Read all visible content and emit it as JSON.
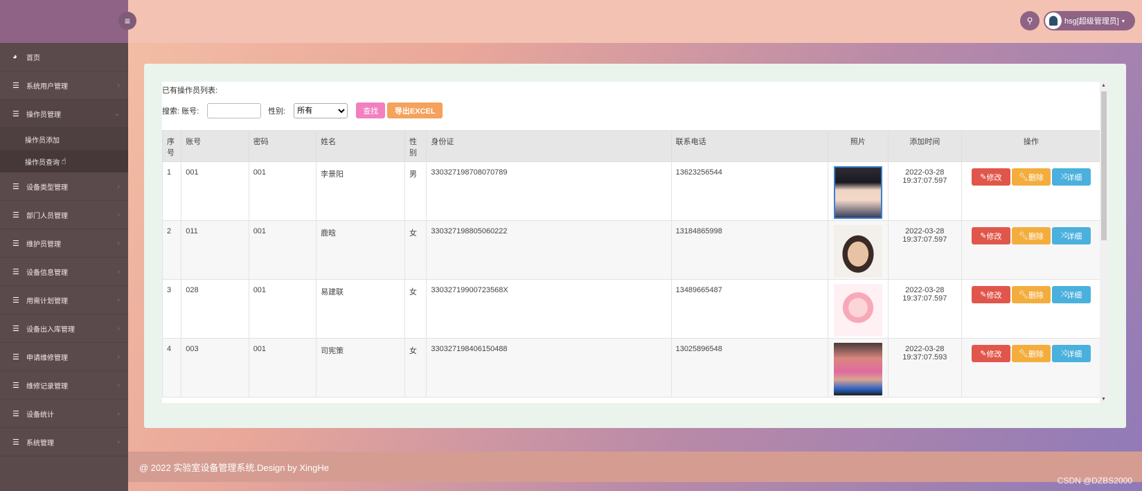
{
  "sidebar": {
    "items": [
      {
        "label": "首页",
        "icon": "dashboard-icon"
      },
      {
        "label": "系统用户管理",
        "icon": "list-icon"
      },
      {
        "label": "操作员管理",
        "icon": "list-icon"
      },
      {
        "label": "设备类型管理",
        "icon": "list-icon"
      },
      {
        "label": "部门人员管理",
        "icon": "list-icon"
      },
      {
        "label": "维护员管理",
        "icon": "list-icon"
      },
      {
        "label": "设备信息管理",
        "icon": "list-icon"
      },
      {
        "label": "用需计划管理",
        "icon": "list-icon"
      },
      {
        "label": "设备出入库管理",
        "icon": "list-icon"
      },
      {
        "label": "申请维修管理",
        "icon": "list-icon"
      },
      {
        "label": "维修记录管理",
        "icon": "list-icon"
      },
      {
        "label": "设备统计",
        "icon": "list-icon"
      },
      {
        "label": "系统管理",
        "icon": "list-icon"
      }
    ],
    "subitems": [
      {
        "label": "操作员添加"
      },
      {
        "label": "操作员查询"
      }
    ]
  },
  "header": {
    "user": "hsg[超级管理员]"
  },
  "main": {
    "list_title": "已有操作员列表:",
    "search_label": "搜索: 账号:",
    "account_value": "",
    "gender_label": "性别:",
    "gender_selected": "所有",
    "find_button": "查找",
    "export_button": "导出EXCEL",
    "columns": [
      "序号",
      "账号",
      "密码",
      "姓名",
      "性别",
      "身份证",
      "联系电话",
      "照片",
      "添加时间",
      "操作"
    ],
    "rows": [
      {
        "no": "1",
        "account": "001",
        "password": "001",
        "name": "李景阳",
        "gender": "男",
        "id_card": "330327198708070789",
        "phone": "13623256544",
        "date": "2022-03-28",
        "time": "19:37:07.597"
      },
      {
        "no": "2",
        "account": "011",
        "password": "001",
        "name": "鹿晗",
        "gender": "女",
        "id_card": "330327198805060222",
        "phone": "13184865998",
        "date": "2022-03-28",
        "time": "19:37:07.597"
      },
      {
        "no": "3",
        "account": "028",
        "password": "001",
        "name": "易建联",
        "gender": "女",
        "id_card": "33032719900723568X",
        "phone": "13489665487",
        "date": "2022-03-28",
        "time": "19:37:07.597"
      },
      {
        "no": "4",
        "account": "003",
        "password": "001",
        "name": "司宪策",
        "gender": "女",
        "id_card": "330327198406150488",
        "phone": "13025896548",
        "date": "2022-03-28",
        "time": "19:37:07.593"
      }
    ],
    "actions": {
      "edit": "修改",
      "delete": "删除",
      "detail": "详细"
    }
  },
  "footer": {
    "text": "@ 2022 实验室设备管理系统.Design by XingHe",
    "watermark": "CSDN @DZBS2000"
  }
}
